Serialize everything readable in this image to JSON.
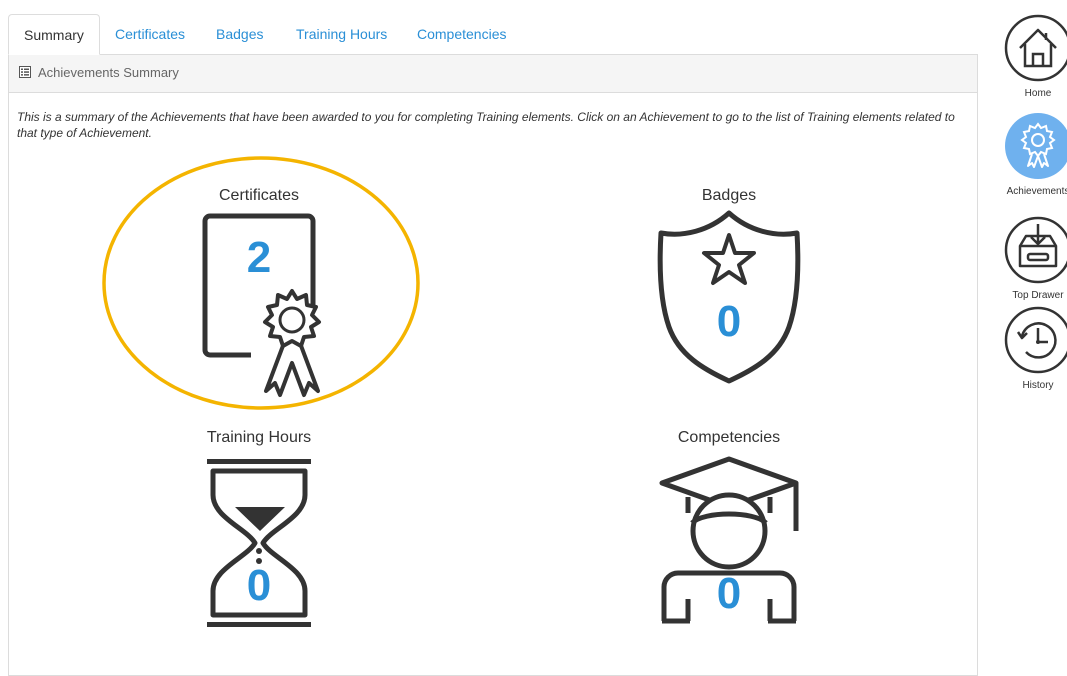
{
  "tabs": [
    {
      "label": "Summary",
      "active": true
    },
    {
      "label": "Certificates"
    },
    {
      "label": "Badges"
    },
    {
      "label": "Training Hours"
    },
    {
      "label": "Competencies"
    }
  ],
  "panel": {
    "title": "Achievements Summary",
    "icon": "list-icon",
    "intro": "This is a summary of the Achievements that have been awarded to you for completing Training elements. Click on an Achievement to go to the list of Training elements related to that type of Achievement."
  },
  "tiles": {
    "certificates": {
      "label": "Certificates",
      "count": "2",
      "icon": "certificate-icon"
    },
    "badges": {
      "label": "Badges",
      "count": "0",
      "icon": "badge-shield-icon"
    },
    "training_hours": {
      "label": "Training Hours",
      "count": "0",
      "icon": "hourglass-icon"
    },
    "competencies": {
      "label": "Competencies",
      "count": "0",
      "icon": "graduate-icon"
    }
  },
  "nav": [
    {
      "label": "Home",
      "icon": "home-icon"
    },
    {
      "label": "Achievements",
      "icon": "award-icon",
      "active": true
    },
    {
      "label": "Top Drawer",
      "icon": "drawer-icon"
    },
    {
      "label": "History",
      "icon": "history-icon"
    }
  ],
  "colors": {
    "accent": "#2a8fd6",
    "highlight": "#f4b400",
    "nav_active": "#6fb1ee"
  }
}
